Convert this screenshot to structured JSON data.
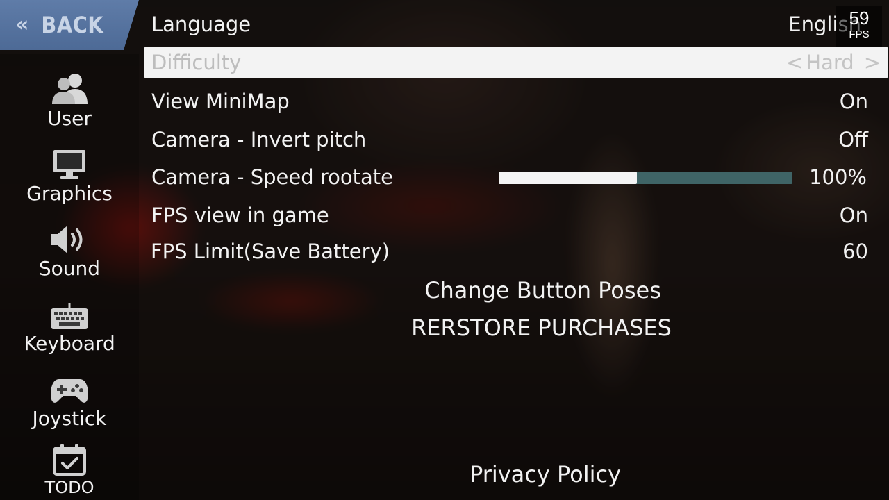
{
  "back": {
    "label": "BACK",
    "chevron": "«"
  },
  "sidebar": {
    "items": [
      {
        "label": "User",
        "icon": "users-icon"
      },
      {
        "label": "Graphics",
        "icon": "monitor-icon"
      },
      {
        "label": "Sound",
        "icon": "speaker-icon"
      },
      {
        "label": "Keyboard",
        "icon": "keyboard-icon"
      },
      {
        "label": "Joystick",
        "icon": "gamepad-icon"
      },
      {
        "label": "TODO",
        "icon": "calendar-check-icon"
      }
    ]
  },
  "settings": {
    "language": {
      "label": "Language",
      "value": "English"
    },
    "difficulty": {
      "label": "Difficulty",
      "value": "Hard",
      "left_arrow": "<",
      "right_arrow": ">"
    },
    "minimap": {
      "label": "View MiniMap",
      "value": "On"
    },
    "invert_pitch": {
      "label": "Camera - Invert pitch",
      "value": "Off"
    },
    "speed_rotate": {
      "label": "Camera - Speed rootate",
      "value": "100%",
      "fill_fraction": 0.47
    },
    "fps_view": {
      "label": "FPS view in game",
      "value": "On"
    },
    "fps_limit": {
      "label": "FPS Limit(Save Battery)",
      "value": "60"
    }
  },
  "links": {
    "change_buttons": "Change Button Poses",
    "restore": "RERSTORE PURCHASES",
    "privacy": "Privacy Policy"
  },
  "fps_counter": {
    "value": "59",
    "unit": "FPS"
  },
  "colors": {
    "back_bg": "#5a77a3",
    "slider_track": "#3f6466",
    "slider_fill": "#f4f4f4",
    "selected_row": "#f3f3f3"
  }
}
